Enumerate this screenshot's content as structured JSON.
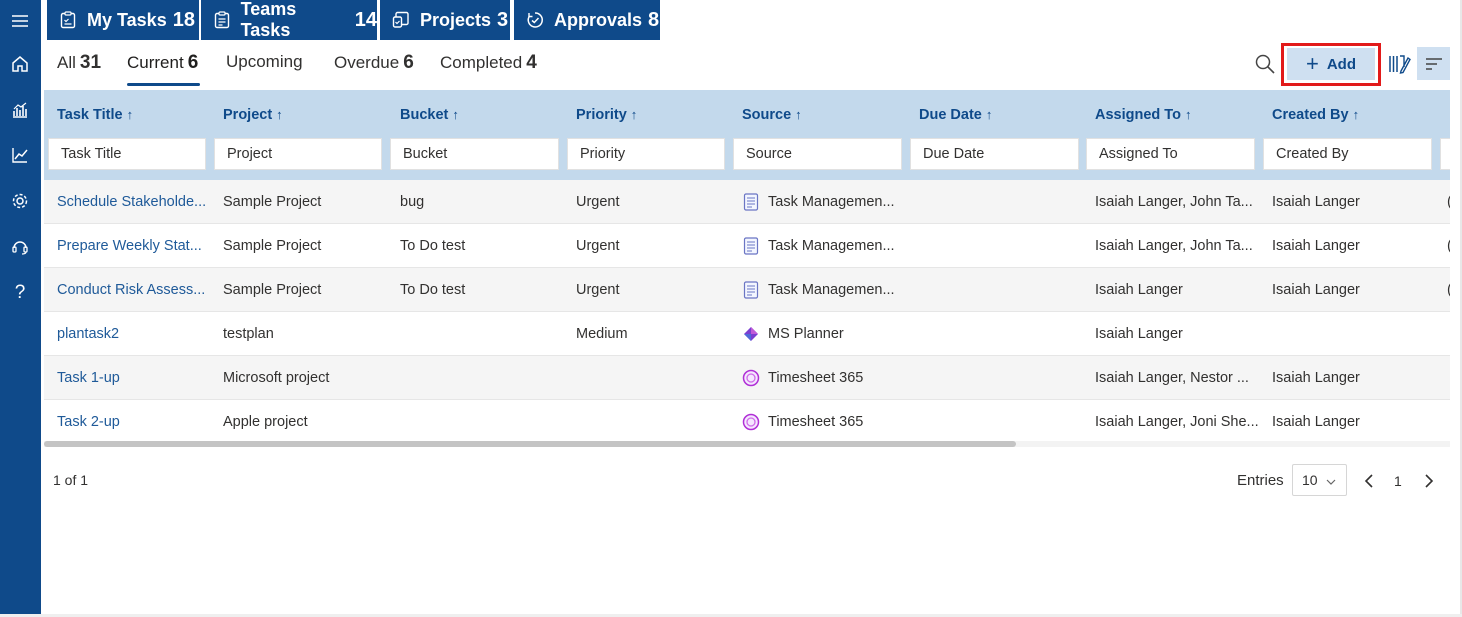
{
  "rail": {
    "icons": [
      "menu-icon",
      "home-icon",
      "analytics-icon",
      "trend-icon",
      "settings-icon",
      "support-icon",
      "help-icon"
    ],
    "help_glyph": "?"
  },
  "top_tabs": [
    {
      "label": "My Tasks",
      "count": "18",
      "icon": "task-list-icon"
    },
    {
      "label": "Teams Tasks",
      "count": "14",
      "icon": "team-task-icon"
    },
    {
      "label": "Projects",
      "count": "3",
      "icon": "projects-icon"
    },
    {
      "label": "Approvals",
      "count": "8",
      "icon": "approvals-icon"
    }
  ],
  "sub_tabs": [
    {
      "label": "All",
      "count": "31"
    },
    {
      "label": "Current",
      "count": "6"
    },
    {
      "label": "Upcoming",
      "count": ""
    },
    {
      "label": "Overdue",
      "count": "6"
    },
    {
      "label": "Completed",
      "count": "4"
    }
  ],
  "active_sub_tab": "Current",
  "toolbar": {
    "add_label": "Add",
    "search_icon": "search-icon",
    "columns_icon": "column-chooser-icon",
    "filter_icon": "filter-lines-icon"
  },
  "columns": [
    {
      "label": "Task Title",
      "arrow": "↑",
      "placeholder": "Task Title"
    },
    {
      "label": "Project",
      "arrow": "↑",
      "placeholder": "Project"
    },
    {
      "label": "Bucket",
      "arrow": "↑",
      "placeholder": "Bucket"
    },
    {
      "label": "Priority",
      "arrow": "↑",
      "placeholder": "Priority"
    },
    {
      "label": "Source",
      "arrow": "↑",
      "placeholder": "Source"
    },
    {
      "label": "Due Date",
      "arrow": "↑",
      "placeholder": "Due Date"
    },
    {
      "label": "Assigned To",
      "arrow": "↑",
      "placeholder": "Assigned To"
    },
    {
      "label": "Created By",
      "arrow": "↑",
      "placeholder": "Created By"
    }
  ],
  "rows": [
    {
      "title": "Schedule Stakeholde...",
      "project": "Sample Project",
      "bucket": "bug",
      "priority": "Urgent",
      "source": "Task Managemen...",
      "source_icon": "document-icon",
      "due": "",
      "assigned": "Isaiah Langer, John Ta...",
      "created": "Isaiah Langer",
      "overflow": "("
    },
    {
      "title": "Prepare Weekly Stat...",
      "project": "Sample Project",
      "bucket": "To Do test",
      "priority": "Urgent",
      "source": "Task Managemen...",
      "source_icon": "document-icon",
      "due": "",
      "assigned": "Isaiah Langer, John Ta...",
      "created": "Isaiah Langer",
      "overflow": "("
    },
    {
      "title": "Conduct Risk Assess...",
      "project": "Sample Project",
      "bucket": "To Do test",
      "priority": "Urgent",
      "source": "Task Managemen...",
      "source_icon": "document-icon",
      "due": "",
      "assigned": "Isaiah Langer",
      "created": "Isaiah Langer",
      "overflow": "("
    },
    {
      "title": "plantask2",
      "project": "testplan",
      "bucket": "",
      "priority": "Medium",
      "source": "MS Planner",
      "source_icon": "planner-icon",
      "due": "",
      "assigned": "Isaiah Langer",
      "created": "",
      "overflow": ""
    },
    {
      "title": "Task 1-up",
      "project": "Microsoft project",
      "bucket": "",
      "priority": "",
      "source": "Timesheet 365",
      "source_icon": "timesheet-icon",
      "due": "",
      "assigned": "Isaiah Langer, Nestor ...",
      "created": "Isaiah Langer",
      "overflow": ""
    },
    {
      "title": "Task 2-up",
      "project": "Apple project",
      "bucket": "",
      "priority": "",
      "source": "Timesheet 365",
      "source_icon": "timesheet-icon",
      "due": "",
      "assigned": "Isaiah Langer, Joni She...",
      "created": "Isaiah Langer",
      "overflow": ""
    }
  ],
  "footer": {
    "page_info": "1 of 1",
    "entries_label": "Entries",
    "entries_value": "10",
    "current_page": "1"
  },
  "colors": {
    "brand": "#0f4a8a",
    "header_bg": "#c3d9ec",
    "add_bg": "#cfe0f1",
    "highlight": "#e21a1a",
    "link": "#1f5a99"
  }
}
